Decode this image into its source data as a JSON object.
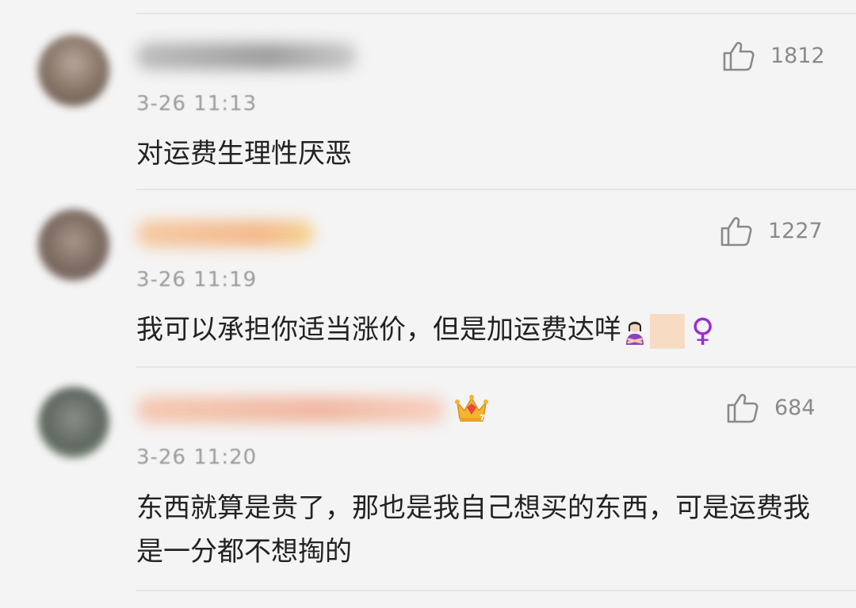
{
  "comments": [
    {
      "timestamp": "3-26 11:13",
      "likes": "1812",
      "text": "对运费生理性厌恶"
    },
    {
      "timestamp": "3-26 11:19",
      "likes": "1227",
      "text": "我可以承担你适当涨价，但是加运费达咩",
      "emoji_tail": [
        "woman-gesturing-no-icon",
        "skin-tone-box",
        "female-sign-icon"
      ],
      "female_sign": "♀"
    },
    {
      "timestamp": "3-26 11:20",
      "likes": "684",
      "text": "东西就算是贵了，那也是我自己想买的东西，可是运费我是一分都不想掏的",
      "badge": "crown-icon"
    }
  ],
  "colors": {
    "background": "#f4f4f4",
    "text": "#222222",
    "meta": "#8a8a8a",
    "female_sign": "#9a2fd0"
  }
}
